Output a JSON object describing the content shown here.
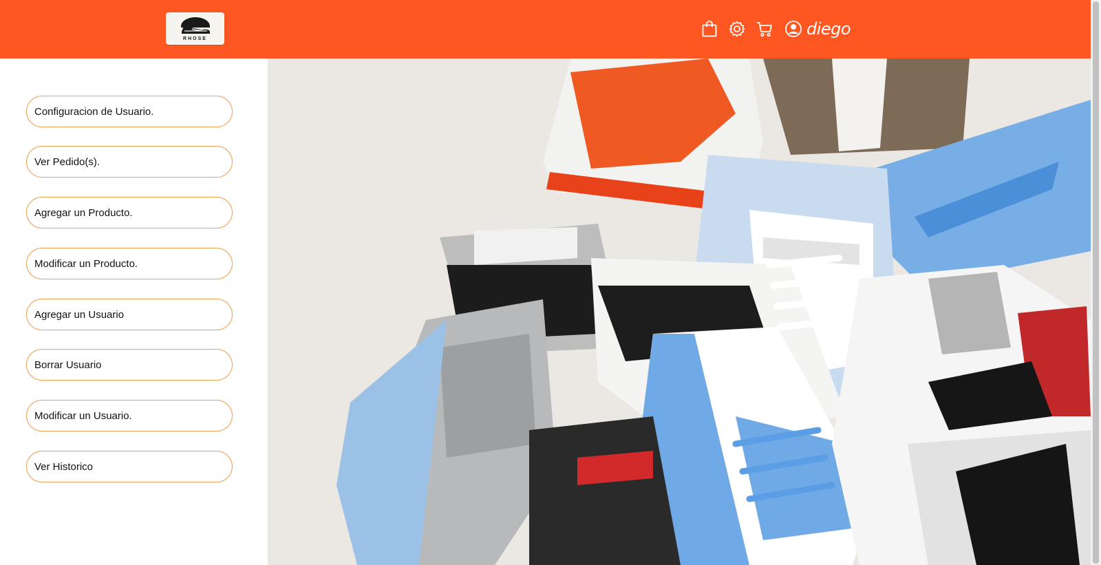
{
  "header": {
    "logo_text": "RHOSE",
    "username": "diego",
    "accent_color": "#ff5722",
    "icons": [
      "shopping-bag-icon",
      "gear-icon",
      "cart-icon",
      "user-circle-icon"
    ]
  },
  "sidebar": {
    "items": [
      {
        "label": "Configuracion de Usuario."
      },
      {
        "label": "Ver Pedido(s)."
      },
      {
        "label": "Agregar un Producto."
      },
      {
        "label": "Modificar un Producto."
      },
      {
        "label": "Agregar un Usuario"
      },
      {
        "label": "Borrar Usuario"
      },
      {
        "label": "Modificar un Usuario."
      },
      {
        "label": "Ver Historico"
      }
    ],
    "border_color": "#f0a050"
  },
  "hero": {
    "image": "sneakers-pile-photo"
  }
}
